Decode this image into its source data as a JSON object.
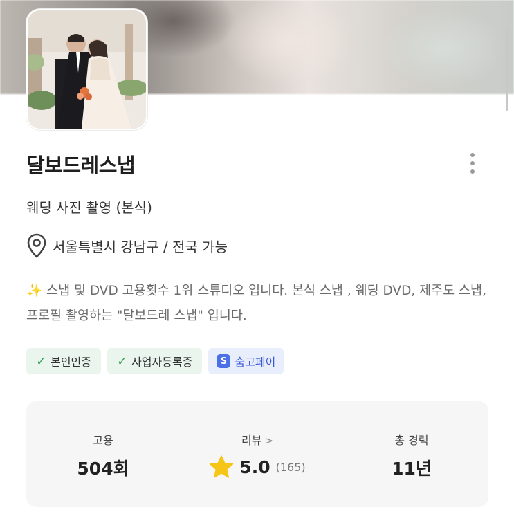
{
  "header": {
    "more_menu_icon": "more-vertical-icon"
  },
  "profile": {
    "name": "달보드레스냅",
    "category": "웨딩 사진 촬영 (본식)",
    "location_icon": "location-pin-icon",
    "location": "서울특별시 강남구 / 전국 가능",
    "description_icon": "sparkle-icon",
    "description": "스냅 및 DVD 고용횟수 1위 스튜디오 입니다. 본식 스냅 , 웨딩 DVD, 제주도 스냅, 프로필 촬영하는  \"달보드레 스냅\" 입니다."
  },
  "badges": [
    {
      "label": "본인인증",
      "icon": "check-icon",
      "color": "#3aa15a"
    },
    {
      "label": "사업자등록증",
      "icon": "check-icon",
      "color": "#3aa15a"
    },
    {
      "label": "숨고페이",
      "icon": "soomgo-pay-icon",
      "color": "#4d6fe8"
    }
  ],
  "stats": {
    "hire": {
      "label": "고용",
      "value": "504회"
    },
    "review": {
      "label": "리뷰",
      "rating": "5.0",
      "count": "(165)",
      "star_color": "#f5c518"
    },
    "career": {
      "label": "총 경력",
      "value": "11년"
    }
  }
}
